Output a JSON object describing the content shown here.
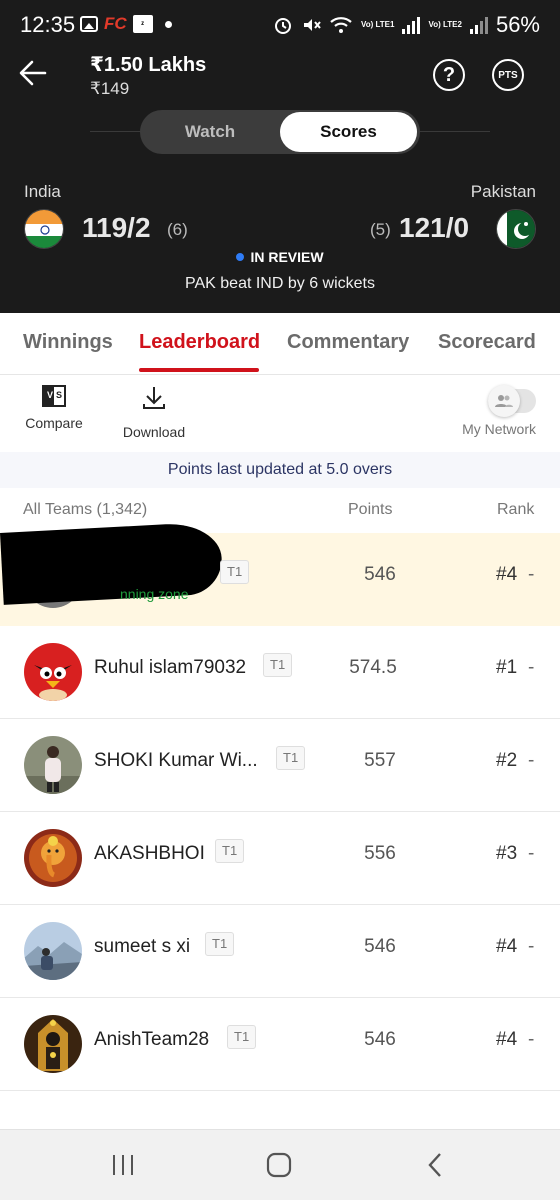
{
  "status_bar": {
    "time": "12:35",
    "app_badge": "FC",
    "battery": "56%",
    "network_1": "Vo) LTE1",
    "network_2": "Vo) LTE2",
    "icons": [
      "gallery-icon",
      "fc-app-icon",
      "zomato-icon",
      "alarm-icon",
      "mute-icon",
      "wifi-icon",
      "signal-icon",
      "battery-icon"
    ]
  },
  "header": {
    "prize": "₹1.50 Lakhs",
    "entry": "₹149",
    "help_icon": "?",
    "pts_label": "PTS"
  },
  "toggle": {
    "watch": "Watch",
    "scores": "Scores",
    "selected": "Scores"
  },
  "match": {
    "team_a": "India",
    "team_a_score": "119/2",
    "team_a_overs": "(6)",
    "team_b": "Pakistan",
    "team_b_score": "121/0",
    "team_b_overs": "(5)",
    "status": "IN REVIEW",
    "result": "PAK beat IND by 6 wickets"
  },
  "tabs": [
    {
      "label": "Winnings"
    },
    {
      "label": "Leaderboard",
      "active": true
    },
    {
      "label": "Commentary"
    },
    {
      "label": "Scorecard"
    }
  ],
  "tools": {
    "compare": "Compare",
    "download": "Download",
    "my_network": "My Network"
  },
  "updated": "Points last updated at 5.0 overs",
  "list_header": {
    "teams": "All Teams (1,342)",
    "points": "Points",
    "rank": "Rank"
  },
  "rows": [
    {
      "name": "",
      "team": "T1",
      "points": "546",
      "rank": "#4",
      "change": "-",
      "note": "nning zone"
    },
    {
      "name": "Ruhul islam79032",
      "team": "T1",
      "points": "574.5",
      "rank": "#1",
      "change": "-"
    },
    {
      "name": "SHOKI Kumar Wi...",
      "team": "T1",
      "points": "557",
      "rank": "#2",
      "change": "-"
    },
    {
      "name": "AKASHBHOI",
      "team": "T1",
      "points": "556",
      "rank": "#3",
      "change": "-"
    },
    {
      "name": "sumeet s xi",
      "team": "T1",
      "points": "546",
      "rank": "#4",
      "change": "-"
    },
    {
      "name": "AnishTeam28",
      "team": "T1",
      "points": "546",
      "rank": "#4",
      "change": "-"
    }
  ],
  "colors": {
    "accent": "#d0121b",
    "header_bg": "#1b1b1b",
    "highlight_row": "#fff7e2",
    "review_dot": "#2f7cf6",
    "winning_zone": "#1f9a3c"
  }
}
